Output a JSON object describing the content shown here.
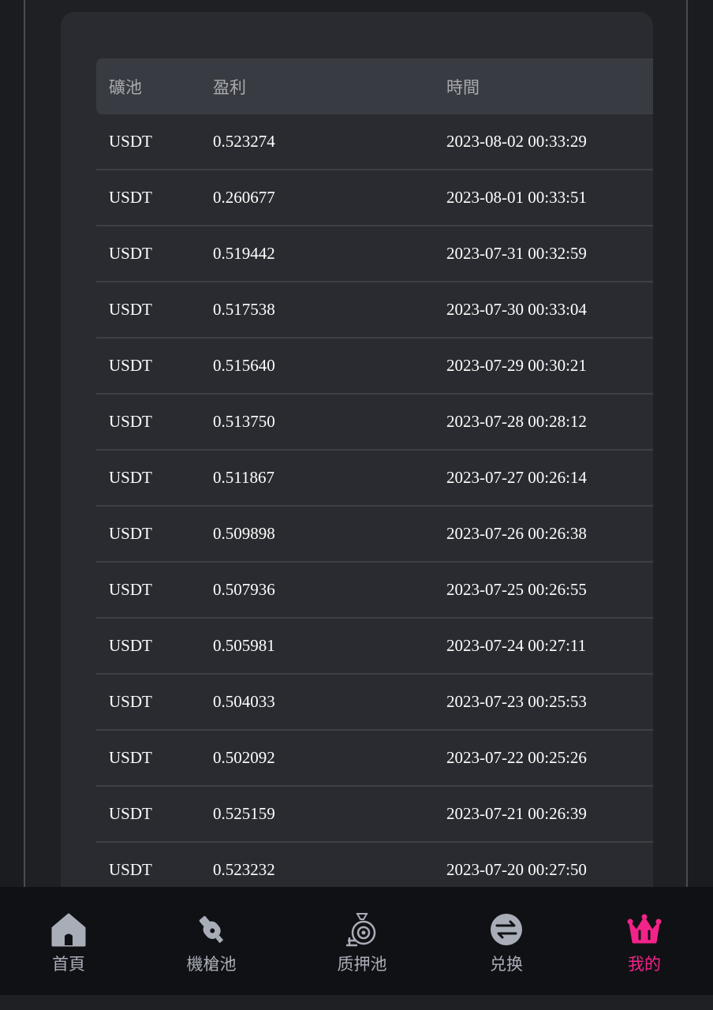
{
  "table": {
    "headers": [
      "礦池",
      "盈利",
      "時間"
    ],
    "rows": [
      [
        "USDT",
        "0.523274",
        "2023-08-02 00:33:29"
      ],
      [
        "USDT",
        "0.260677",
        "2023-08-01 00:33:51"
      ],
      [
        "USDT",
        "0.519442",
        "2023-07-31 00:32:59"
      ],
      [
        "USDT",
        "0.517538",
        "2023-07-30 00:33:04"
      ],
      [
        "USDT",
        "0.515640",
        "2023-07-29 00:30:21"
      ],
      [
        "USDT",
        "0.513750",
        "2023-07-28 00:28:12"
      ],
      [
        "USDT",
        "0.511867",
        "2023-07-27 00:26:14"
      ],
      [
        "USDT",
        "0.509898",
        "2023-07-26 00:26:38"
      ],
      [
        "USDT",
        "0.507936",
        "2023-07-25 00:26:55"
      ],
      [
        "USDT",
        "0.505981",
        "2023-07-24 00:27:11"
      ],
      [
        "USDT",
        "0.504033",
        "2023-07-23 00:25:53"
      ],
      [
        "USDT",
        "0.502092",
        "2023-07-22 00:25:26"
      ],
      [
        "USDT",
        "0.525159",
        "2023-07-21 00:26:39"
      ],
      [
        "USDT",
        "0.523232",
        "2023-07-20 00:27:50"
      ]
    ]
  },
  "tabbar": {
    "items": [
      {
        "label": "首頁",
        "icon": "home-icon",
        "active": false
      },
      {
        "label": "機槍池",
        "icon": "rocket-icon",
        "active": false
      },
      {
        "label": "质押池",
        "icon": "money-bag-icon",
        "active": false
      },
      {
        "label": "兑换",
        "icon": "exchange-icon",
        "active": false
      },
      {
        "label": "我的",
        "icon": "crown-icon",
        "active": true
      }
    ]
  },
  "colors": {
    "background": "#1b1c20",
    "card": "#2a2b30",
    "header_row": "#393b42",
    "tab_inactive": "#a9adb8",
    "tab_active": "#f2238a"
  }
}
